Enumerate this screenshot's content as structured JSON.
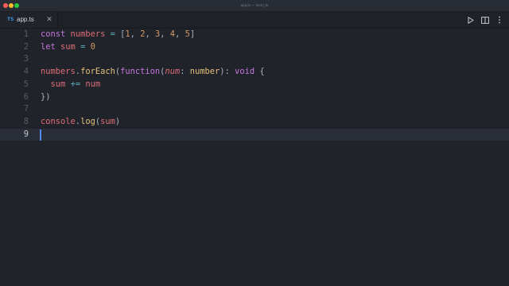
{
  "window": {
    "title": "app.ts — learn_ts"
  },
  "tab": {
    "icon_text": "TS",
    "label": "app.ts",
    "close": "✕"
  },
  "toolbar": {
    "run_icon": "play-icon",
    "split_icon": "split-editor-icon",
    "more_icon": "more-icon"
  },
  "editor": {
    "language": "typescript",
    "active_line": 9,
    "lines": [
      {
        "number": "1",
        "text": "const numbers = [1, 2, 3, 4, 5]"
      },
      {
        "number": "2",
        "text": "let sum = 0"
      },
      {
        "number": "3",
        "text": ""
      },
      {
        "number": "4",
        "text": "numbers.forEach(function(num: number): void {"
      },
      {
        "number": "5",
        "text": "  sum += num"
      },
      {
        "number": "6",
        "text": "})"
      },
      {
        "number": "7",
        "text": ""
      },
      {
        "number": "8",
        "text": "console.log(sum)"
      },
      {
        "number": "9",
        "text": ""
      }
    ]
  },
  "colors": {
    "background": "#20232a",
    "keyword": "#c678dd",
    "variable": "#e06c75",
    "function": "#e5c07b",
    "number": "#d19a66",
    "cursor": "#528bff",
    "ts_icon": "#3a8fd9"
  }
}
